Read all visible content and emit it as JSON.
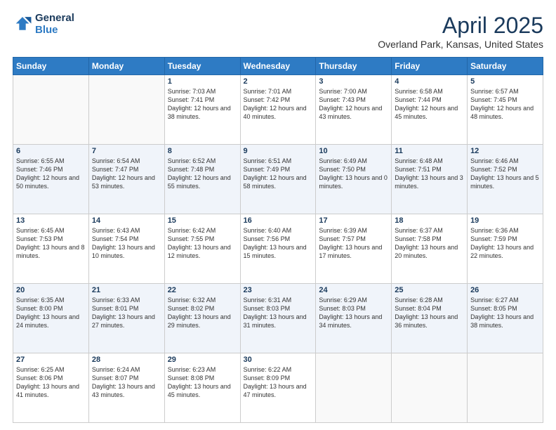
{
  "header": {
    "logo_general": "General",
    "logo_blue": "Blue",
    "month": "April 2025",
    "location": "Overland Park, Kansas, United States"
  },
  "days_of_week": [
    "Sunday",
    "Monday",
    "Tuesday",
    "Wednesday",
    "Thursday",
    "Friday",
    "Saturday"
  ],
  "weeks": [
    [
      {
        "day": "",
        "info": ""
      },
      {
        "day": "",
        "info": ""
      },
      {
        "day": "1",
        "info": "Sunrise: 7:03 AM\nSunset: 7:41 PM\nDaylight: 12 hours and 38 minutes."
      },
      {
        "day": "2",
        "info": "Sunrise: 7:01 AM\nSunset: 7:42 PM\nDaylight: 12 hours and 40 minutes."
      },
      {
        "day": "3",
        "info": "Sunrise: 7:00 AM\nSunset: 7:43 PM\nDaylight: 12 hours and 43 minutes."
      },
      {
        "day": "4",
        "info": "Sunrise: 6:58 AM\nSunset: 7:44 PM\nDaylight: 12 hours and 45 minutes."
      },
      {
        "day": "5",
        "info": "Sunrise: 6:57 AM\nSunset: 7:45 PM\nDaylight: 12 hours and 48 minutes."
      }
    ],
    [
      {
        "day": "6",
        "info": "Sunrise: 6:55 AM\nSunset: 7:46 PM\nDaylight: 12 hours and 50 minutes."
      },
      {
        "day": "7",
        "info": "Sunrise: 6:54 AM\nSunset: 7:47 PM\nDaylight: 12 hours and 53 minutes."
      },
      {
        "day": "8",
        "info": "Sunrise: 6:52 AM\nSunset: 7:48 PM\nDaylight: 12 hours and 55 minutes."
      },
      {
        "day": "9",
        "info": "Sunrise: 6:51 AM\nSunset: 7:49 PM\nDaylight: 12 hours and 58 minutes."
      },
      {
        "day": "10",
        "info": "Sunrise: 6:49 AM\nSunset: 7:50 PM\nDaylight: 13 hours and 0 minutes."
      },
      {
        "day": "11",
        "info": "Sunrise: 6:48 AM\nSunset: 7:51 PM\nDaylight: 13 hours and 3 minutes."
      },
      {
        "day": "12",
        "info": "Sunrise: 6:46 AM\nSunset: 7:52 PM\nDaylight: 13 hours and 5 minutes."
      }
    ],
    [
      {
        "day": "13",
        "info": "Sunrise: 6:45 AM\nSunset: 7:53 PM\nDaylight: 13 hours and 8 minutes."
      },
      {
        "day": "14",
        "info": "Sunrise: 6:43 AM\nSunset: 7:54 PM\nDaylight: 13 hours and 10 minutes."
      },
      {
        "day": "15",
        "info": "Sunrise: 6:42 AM\nSunset: 7:55 PM\nDaylight: 13 hours and 12 minutes."
      },
      {
        "day": "16",
        "info": "Sunrise: 6:40 AM\nSunset: 7:56 PM\nDaylight: 13 hours and 15 minutes."
      },
      {
        "day": "17",
        "info": "Sunrise: 6:39 AM\nSunset: 7:57 PM\nDaylight: 13 hours and 17 minutes."
      },
      {
        "day": "18",
        "info": "Sunrise: 6:37 AM\nSunset: 7:58 PM\nDaylight: 13 hours and 20 minutes."
      },
      {
        "day": "19",
        "info": "Sunrise: 6:36 AM\nSunset: 7:59 PM\nDaylight: 13 hours and 22 minutes."
      }
    ],
    [
      {
        "day": "20",
        "info": "Sunrise: 6:35 AM\nSunset: 8:00 PM\nDaylight: 13 hours and 24 minutes."
      },
      {
        "day": "21",
        "info": "Sunrise: 6:33 AM\nSunset: 8:01 PM\nDaylight: 13 hours and 27 minutes."
      },
      {
        "day": "22",
        "info": "Sunrise: 6:32 AM\nSunset: 8:02 PM\nDaylight: 13 hours and 29 minutes."
      },
      {
        "day": "23",
        "info": "Sunrise: 6:31 AM\nSunset: 8:03 PM\nDaylight: 13 hours and 31 minutes."
      },
      {
        "day": "24",
        "info": "Sunrise: 6:29 AM\nSunset: 8:03 PM\nDaylight: 13 hours and 34 minutes."
      },
      {
        "day": "25",
        "info": "Sunrise: 6:28 AM\nSunset: 8:04 PM\nDaylight: 13 hours and 36 minutes."
      },
      {
        "day": "26",
        "info": "Sunrise: 6:27 AM\nSunset: 8:05 PM\nDaylight: 13 hours and 38 minutes."
      }
    ],
    [
      {
        "day": "27",
        "info": "Sunrise: 6:25 AM\nSunset: 8:06 PM\nDaylight: 13 hours and 41 minutes."
      },
      {
        "day": "28",
        "info": "Sunrise: 6:24 AM\nSunset: 8:07 PM\nDaylight: 13 hours and 43 minutes."
      },
      {
        "day": "29",
        "info": "Sunrise: 6:23 AM\nSunset: 8:08 PM\nDaylight: 13 hours and 45 minutes."
      },
      {
        "day": "30",
        "info": "Sunrise: 6:22 AM\nSunset: 8:09 PM\nDaylight: 13 hours and 47 minutes."
      },
      {
        "day": "",
        "info": ""
      },
      {
        "day": "",
        "info": ""
      },
      {
        "day": "",
        "info": ""
      }
    ]
  ]
}
